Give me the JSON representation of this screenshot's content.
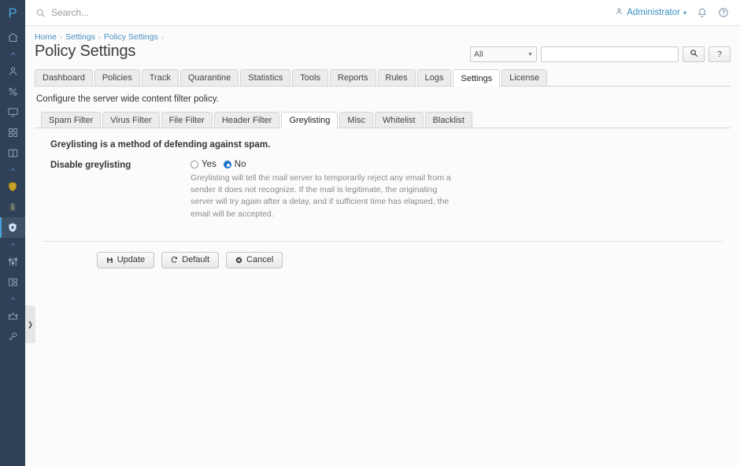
{
  "sidebar": {
    "logo": "P",
    "items": [
      {
        "name": "home-icon",
        "icon": "home"
      },
      {
        "name": "chevron-up-icon",
        "icon": "chevron-up"
      },
      {
        "name": "user-icon",
        "icon": "user"
      },
      {
        "name": "percent-icon",
        "icon": "percent"
      },
      {
        "name": "monitor-icon",
        "icon": "monitor"
      },
      {
        "name": "grid-icon",
        "icon": "grid"
      },
      {
        "name": "book-icon",
        "icon": "book"
      },
      {
        "name": "chevron-up-icon",
        "icon": "chevron-up"
      },
      {
        "name": "shield-gold-icon",
        "icon": "shield-gold"
      },
      {
        "name": "bug-icon",
        "icon": "bug"
      },
      {
        "name": "shield-policy-icon",
        "icon": "shield-active"
      },
      {
        "name": "chevron-up-icon",
        "icon": "chevron-up"
      },
      {
        "name": "sliders-icon",
        "icon": "sliders"
      },
      {
        "name": "layout-icon",
        "icon": "layout"
      },
      {
        "name": "chevron-up-icon",
        "icon": "chevron-up"
      },
      {
        "name": "crown-icon",
        "icon": "crown"
      },
      {
        "name": "key-icon",
        "icon": "key"
      }
    ],
    "collapse_chevron": "❯"
  },
  "topbar": {
    "search_placeholder": "Search...",
    "search_value": "",
    "user_label": "Administrator",
    "user_caret": "▾",
    "notification_icon": "bell-icon",
    "help_icon": "question-circle-icon"
  },
  "breadcrumb": {
    "items": [
      "Home",
      "Settings",
      "Policy Settings"
    ],
    "separator": "›",
    "trailing_separator": "›"
  },
  "header": {
    "title": "Policy Settings"
  },
  "filterbar": {
    "select_value": "All",
    "select_caret": "▼",
    "input_value": "",
    "input_placeholder": "",
    "search_button_icon": "⚲",
    "help_button_label": "?"
  },
  "main_tabs": {
    "items": [
      "Dashboard",
      "Policies",
      "Track",
      "Quarantine",
      "Statistics",
      "Tools",
      "Reports",
      "Rules",
      "Logs",
      "Settings",
      "License"
    ],
    "active": "Settings"
  },
  "section": {
    "description": "Configure the server wide content filter policy."
  },
  "sub_tabs": {
    "items": [
      "Spam Filter",
      "Virus Filter",
      "File Filter",
      "Header Filter",
      "Greylisting",
      "Misc",
      "Whitelist",
      "Blacklist"
    ],
    "active": "Greylisting"
  },
  "form": {
    "lead": "Greylisting is a method of defending against spam.",
    "field_label": "Disable greylisting",
    "options": [
      {
        "label": "Yes",
        "selected": false
      },
      {
        "label": "No",
        "selected": true
      }
    ],
    "help_text": "Greylisting will tell the mail server to temporarily reject any email from a sender it does not recognize. If the mail is legitimate, the originating server will try again after a delay, and if sufficient time has elapsed, the email will be accepted."
  },
  "buttons": [
    {
      "label": "Update",
      "icon": "💾",
      "name": "update-button"
    },
    {
      "label": "Default",
      "icon": "↺",
      "name": "default-button"
    },
    {
      "label": "Cancel",
      "icon": "⊗",
      "name": "cancel-button"
    }
  ],
  "colors": {
    "sidebar_bg": "#2f4156",
    "accent": "#4aa3df",
    "link": "#4a90c4",
    "radio_on": "#1a73c8"
  }
}
